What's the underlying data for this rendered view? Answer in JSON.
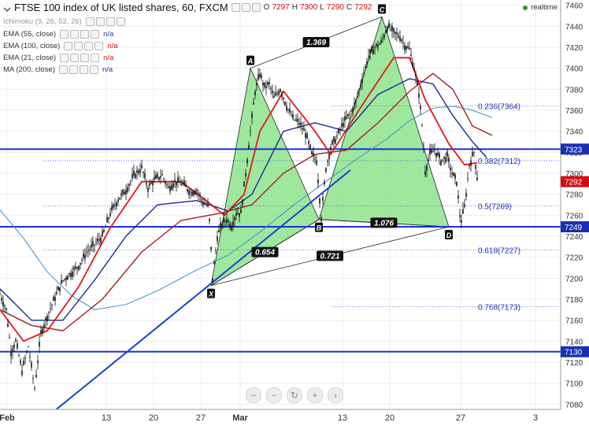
{
  "header": {
    "title": "FTSE 100 index of UK listed shares, 60, FXCM",
    "ohlc": {
      "o_label": "O",
      "o": "7297",
      "h_label": "H",
      "h": "7300",
      "l_label": "L",
      "l": "7290",
      "c_label": "C",
      "c": "7292"
    },
    "realtime": "realtime"
  },
  "indicators": [
    {
      "label": "Ichimoku (9, 26, 52, 26)",
      "value": "",
      "color": "#999999"
    },
    {
      "label": "EMA (55, close)",
      "value": "n/a",
      "color": "#1a3fa0"
    },
    {
      "label": "EMA (100, close)",
      "value": "n/a",
      "color": "#d01010"
    },
    {
      "label": "EMA (21, close)",
      "value": "n/a",
      "color": "#d01010"
    },
    {
      "label": "MA (200, close)",
      "value": "n/a",
      "color": "#1a3fa0"
    }
  ],
  "nav_buttons": [
    "−",
    "−",
    "↻",
    "+",
    "›"
  ],
  "chart_data": {
    "type": "line",
    "ylim": [
      7075,
      7465
    ],
    "y_ticks": [
      7080,
      7100,
      7120,
      7140,
      7160,
      7180,
      7200,
      7220,
      7240,
      7260,
      7280,
      7300,
      7320,
      7340,
      7360,
      7380,
      7400,
      7420,
      7440,
      7460
    ],
    "x_ticks": [
      {
        "label": "Feb",
        "bar": 9
      },
      {
        "label": "13",
        "bar": 135
      },
      {
        "label": "20",
        "bar": 195
      },
      {
        "label": "27",
        "bar": 255
      },
      {
        "label": "Mar",
        "bar": 305
      },
      {
        "label": "13",
        "bar": 435
      },
      {
        "label": "20",
        "bar": 495
      },
      {
        "label": "27",
        "bar": 585
      },
      {
        "label": "3",
        "bar": 680
      }
    ],
    "price_keypoints": [
      [
        0,
        7185
      ],
      [
        8,
        7170
      ],
      [
        14,
        7130
      ],
      [
        20,
        7140
      ],
      [
        28,
        7112
      ],
      [
        36,
        7135
      ],
      [
        44,
        7095
      ],
      [
        52,
        7148
      ],
      [
        62,
        7168
      ],
      [
        70,
        7182
      ],
      [
        80,
        7198
      ],
      [
        90,
        7205
      ],
      [
        100,
        7212
      ],
      [
        110,
        7225
      ],
      [
        120,
        7232
      ],
      [
        130,
        7240
      ],
      [
        140,
        7262
      ],
      [
        150,
        7275
      ],
      [
        160,
        7284
      ],
      [
        170,
        7298
      ],
      [
        180,
        7305
      ],
      [
        188,
        7286
      ],
      [
        196,
        7294
      ],
      [
        206,
        7298
      ],
      [
        214,
        7286
      ],
      [
        222,
        7292
      ],
      [
        232,
        7290
      ],
      [
        242,
        7282
      ],
      [
        250,
        7284
      ],
      [
        258,
        7272
      ],
      [
        265,
        7268
      ],
      [
        270,
        7200
      ],
      [
        276,
        7240
      ],
      [
        282,
        7252
      ],
      [
        288,
        7256
      ],
      [
        294,
        7250
      ],
      [
        300,
        7262
      ],
      [
        306,
        7262
      ],
      [
        312,
        7300
      ],
      [
        318,
        7340
      ],
      [
        324,
        7378
      ],
      [
        330,
        7395
      ],
      [
        336,
        7382
      ],
      [
        342,
        7385
      ],
      [
        348,
        7372
      ],
      [
        356,
        7380
      ],
      [
        364,
        7364
      ],
      [
        372,
        7352
      ],
      [
        380,
        7348
      ],
      [
        388,
        7338
      ],
      [
        396,
        7318
      ],
      [
        402,
        7312
      ],
      [
        408,
        7258
      ],
      [
        414,
        7305
      ],
      [
        420,
        7325
      ],
      [
        428,
        7335
      ],
      [
        436,
        7348
      ],
      [
        444,
        7356
      ],
      [
        452,
        7368
      ],
      [
        460,
        7390
      ],
      [
        468,
        7412
      ],
      [
        476,
        7420
      ],
      [
        484,
        7424
      ],
      [
        492,
        7440
      ],
      [
        500,
        7434
      ],
      [
        508,
        7430
      ],
      [
        514,
        7422
      ],
      [
        520,
        7418
      ],
      [
        526,
        7400
      ],
      [
        532,
        7376
      ],
      [
        536,
        7346
      ],
      [
        540,
        7302
      ],
      [
        546,
        7318
      ],
      [
        552,
        7322
      ],
      [
        560,
        7312
      ],
      [
        568,
        7316
      ],
      [
        574,
        7300
      ],
      [
        580,
        7292
      ],
      [
        585,
        7252
      ],
      [
        590,
        7268
      ],
      [
        596,
        7308
      ],
      [
        602,
        7320
      ],
      [
        606,
        7296
      ]
    ],
    "ema21": [
      [
        0,
        7170
      ],
      [
        30,
        7140
      ],
      [
        60,
        7150
      ],
      [
        100,
        7192
      ],
      [
        140,
        7248
      ],
      [
        180,
        7292
      ],
      [
        230,
        7292
      ],
      [
        260,
        7275
      ],
      [
        285,
        7260
      ],
      [
        310,
        7280
      ],
      [
        330,
        7340
      ],
      [
        360,
        7378
      ],
      [
        400,
        7340
      ],
      [
        420,
        7318
      ],
      [
        460,
        7365
      ],
      [
        500,
        7410
      ],
      [
        520,
        7410
      ],
      [
        540,
        7370
      ],
      [
        570,
        7328
      ],
      [
        590,
        7308
      ],
      [
        606,
        7310
      ]
    ],
    "ema55": [
      [
        0,
        7190
      ],
      [
        40,
        7160
      ],
      [
        80,
        7160
      ],
      [
        120,
        7198
      ],
      [
        160,
        7240
      ],
      [
        200,
        7270
      ],
      [
        250,
        7274
      ],
      [
        290,
        7264
      ],
      [
        320,
        7280
      ],
      [
        360,
        7340
      ],
      [
        400,
        7348
      ],
      [
        440,
        7340
      ],
      [
        480,
        7375
      ],
      [
        520,
        7390
      ],
      [
        550,
        7385
      ],
      [
        575,
        7355
      ],
      [
        600,
        7330
      ],
      [
        618,
        7315
      ]
    ],
    "ema100": [
      [
        0,
        7170
      ],
      [
        40,
        7155
      ],
      [
        80,
        7150
      ],
      [
        130,
        7180
      ],
      [
        180,
        7225
      ],
      [
        230,
        7255
      ],
      [
        280,
        7262
      ],
      [
        320,
        7270
      ],
      [
        360,
        7300
      ],
      [
        400,
        7318
      ],
      [
        440,
        7322
      ],
      [
        480,
        7348
      ],
      [
        520,
        7378
      ],
      [
        550,
        7395
      ],
      [
        575,
        7380
      ],
      [
        600,
        7345
      ],
      [
        625,
        7336
      ]
    ],
    "ma200": [
      [
        0,
        7265
      ],
      [
        30,
        7238
      ],
      [
        60,
        7206
      ],
      [
        90,
        7184
      ],
      [
        120,
        7170
      ],
      [
        160,
        7175
      ],
      [
        200,
        7188
      ],
      [
        250,
        7208
      ],
      [
        290,
        7222
      ],
      [
        330,
        7244
      ],
      [
        370,
        7268
      ],
      [
        410,
        7290
      ],
      [
        450,
        7312
      ],
      [
        490,
        7332
      ],
      [
        520,
        7350
      ],
      [
        550,
        7362
      ],
      [
        575,
        7364
      ],
      [
        600,
        7360
      ],
      [
        625,
        7353
      ]
    ],
    "pattern": {
      "points": [
        {
          "label": "X",
          "bar": 268,
          "price": 7193
        },
        {
          "label": "A",
          "bar": 318,
          "price": 7400
        },
        {
          "label": "B",
          "bar": 405,
          "price": 7256
        },
        {
          "label": "C",
          "bar": 485,
          "price": 7449
        },
        {
          "label": "D",
          "bar": 570,
          "price": 7249
        }
      ],
      "ratios": [
        {
          "label": "1.369",
          "from": "A",
          "to": "C"
        },
        {
          "label": "0.654",
          "from": "X",
          "to": "B"
        },
        {
          "label": "1.076",
          "from": "B",
          "to": "D"
        },
        {
          "label": "0.721",
          "from": "X",
          "to": "D"
        }
      ]
    },
    "fib_levels": [
      {
        "label": "0.236(7364)",
        "price": 7364
      },
      {
        "label": "0.382(7312)",
        "price": 7312
      },
      {
        "label": "0.5(7269)",
        "price": 7269
      },
      {
        "label": "0.618(7227)",
        "price": 7227
      },
      {
        "label": "0.768(7173)",
        "price": 7173
      }
    ],
    "horizontal_lines": [
      {
        "price": 7323,
        "label": "7323"
      },
      {
        "price": 7249,
        "label": "7249"
      },
      {
        "price": 7130,
        "label": "7130"
      }
    ],
    "trendline": {
      "from": {
        "bar": 60,
        "price": 7068
      },
      "to": {
        "bar": 445,
        "price": 7303
      }
    },
    "current_price": {
      "price": 7292,
      "label": "7292",
      "color": "#d01010"
    }
  },
  "colors": {
    "pattern_fill": "#7ee07e",
    "candle": "#111111",
    "axis_box": "#1a2fb0",
    "hline": "#1a2fd0",
    "trend": "#1a3fd0"
  }
}
